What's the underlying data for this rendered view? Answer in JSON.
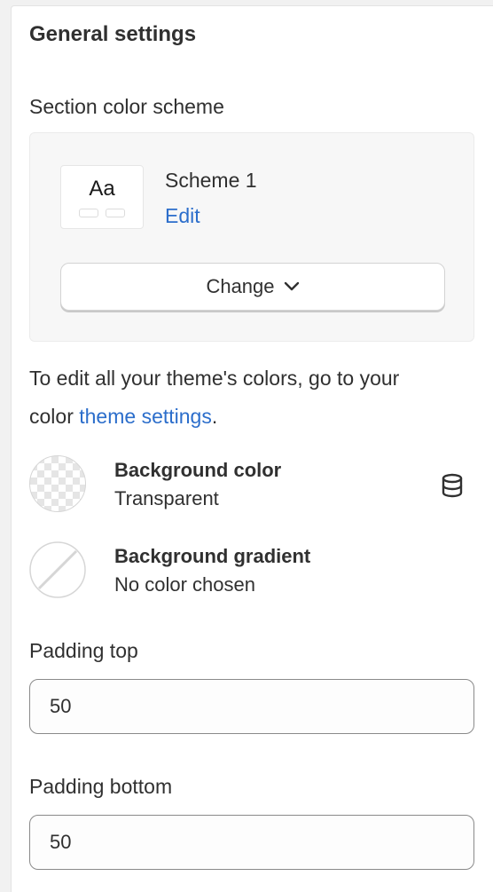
{
  "panel": {
    "title": "General settings",
    "color_scheme": {
      "label": "Section color scheme",
      "swatch_text": "Aa",
      "name": "Scheme 1",
      "edit_label": "Edit",
      "change_label": "Change"
    },
    "help": {
      "text_before": "To edit all your theme's colors, go to your color ",
      "link": "theme settings",
      "text_after": "."
    },
    "background_color": {
      "title": "Background color",
      "value": "Transparent",
      "icon": "database-icon"
    },
    "background_gradient": {
      "title": "Background gradient",
      "value": "No color chosen"
    },
    "padding_top": {
      "label": "Padding top",
      "value": "50"
    },
    "padding_bottom": {
      "label": "Padding bottom",
      "value": "50"
    }
  },
  "colors": {
    "link": "#2c6ecb",
    "text": "#303030",
    "card": "#f7f7f7"
  }
}
